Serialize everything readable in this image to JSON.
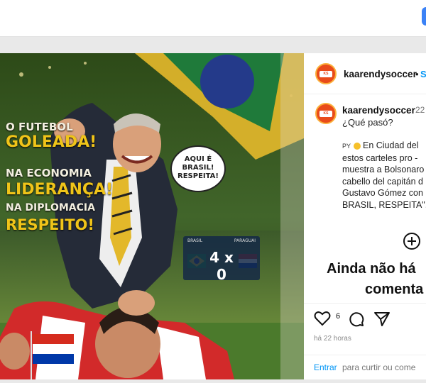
{
  "poster": {
    "line1": "O FUTEBOL",
    "line2": "GOLEADA!",
    "line3": "NA ECONOMIA",
    "line4": "LIDERANÇA!",
    "line5": "NA DIPLOMACIA",
    "line6": "RESPEITO!",
    "bubble_line1": "AQUI É",
    "bubble_line2": "BRASIL!",
    "bubble_line3": "RESPEITA!",
    "team_left": "BRASIL",
    "team_right": "PARAGUAI",
    "score": "4 x 0"
  },
  "post": {
    "username": "kaarendysoccer",
    "separator": "•",
    "follow_label": "S",
    "caption_username": "kaarendysoccer",
    "caption_time": "22",
    "caption_question": "¿Qué pasó?",
    "caption_flag": "PY",
    "caption_lines": [
      "En Ciudad del",
      "estos carteles pro -",
      "muestra a Bolsonaro",
      "cabello del capitán d",
      "Gustavo Gómez con",
      "BRASIL, RESPEITA\"."
    ],
    "empty_title_1": "Ainda não há",
    "empty_title_2": "comenta",
    "likes": "6",
    "timestamp": "há 22 horas",
    "login_link": "Entrar",
    "login_rest": "para curtir ou come"
  }
}
